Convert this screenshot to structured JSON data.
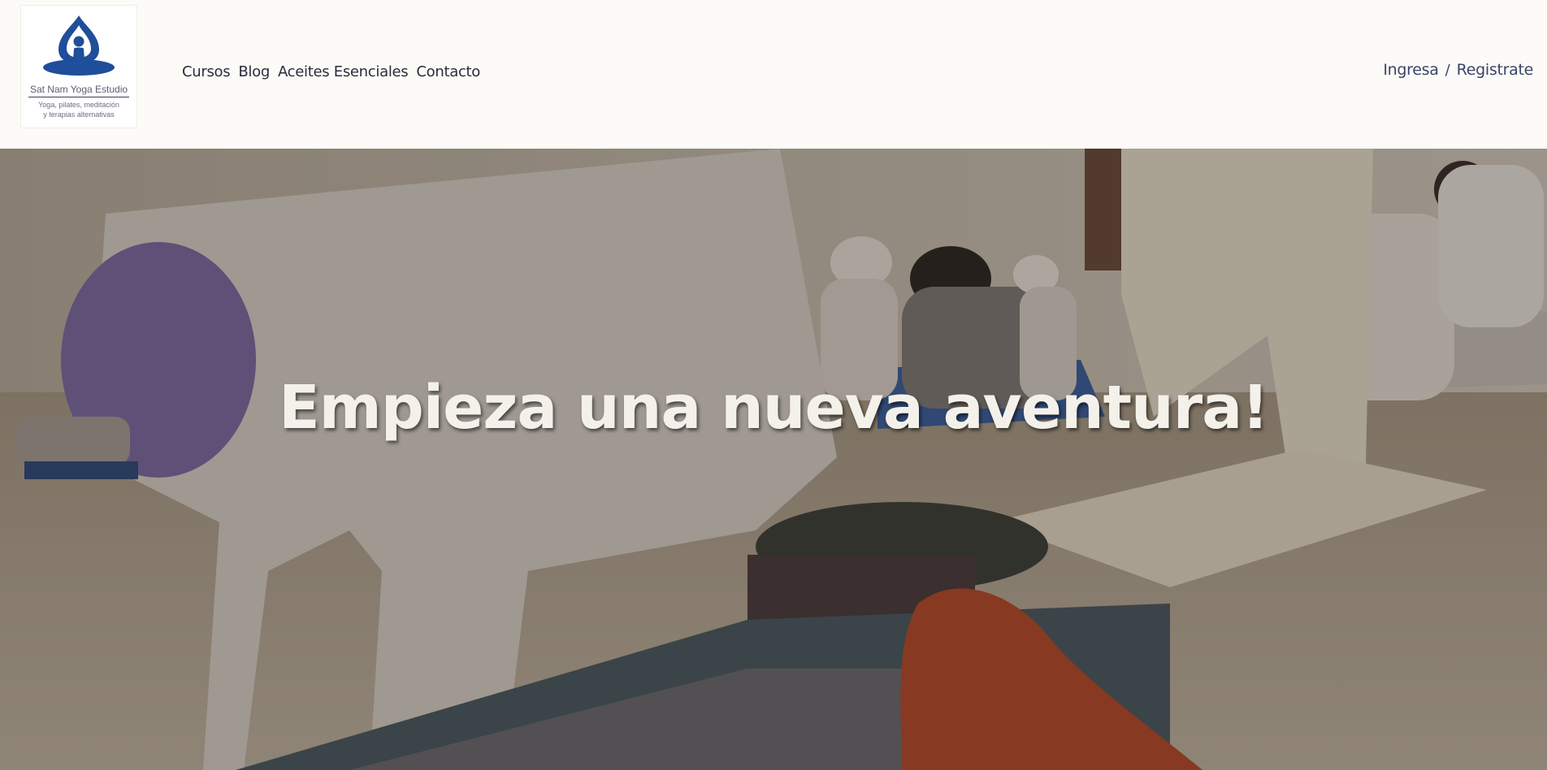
{
  "brand": {
    "name": "Sat Nam Yoga Estudio",
    "tagline_line1": "Yoga, pilates, meditación",
    "tagline_line2": "y terapias alternativas",
    "color": "#1f4e9a"
  },
  "nav": {
    "items": [
      {
        "label": "Cursos"
      },
      {
        "label": "Blog"
      },
      {
        "label": "Aceites Esenciales"
      },
      {
        "label": "Contacto"
      }
    ]
  },
  "auth": {
    "login_label": "Ingresa",
    "separator": "/",
    "register_label": "Registrate"
  },
  "hero": {
    "title": "Empieza una nueva aventura!",
    "image_alt_icon": "yoga-class-photo"
  },
  "colors": {
    "header_bg": "#fcfbf8",
    "nav_text": "#2a2e3b",
    "auth_text": "#3b4468",
    "hero_text": "#f4f0ea"
  }
}
